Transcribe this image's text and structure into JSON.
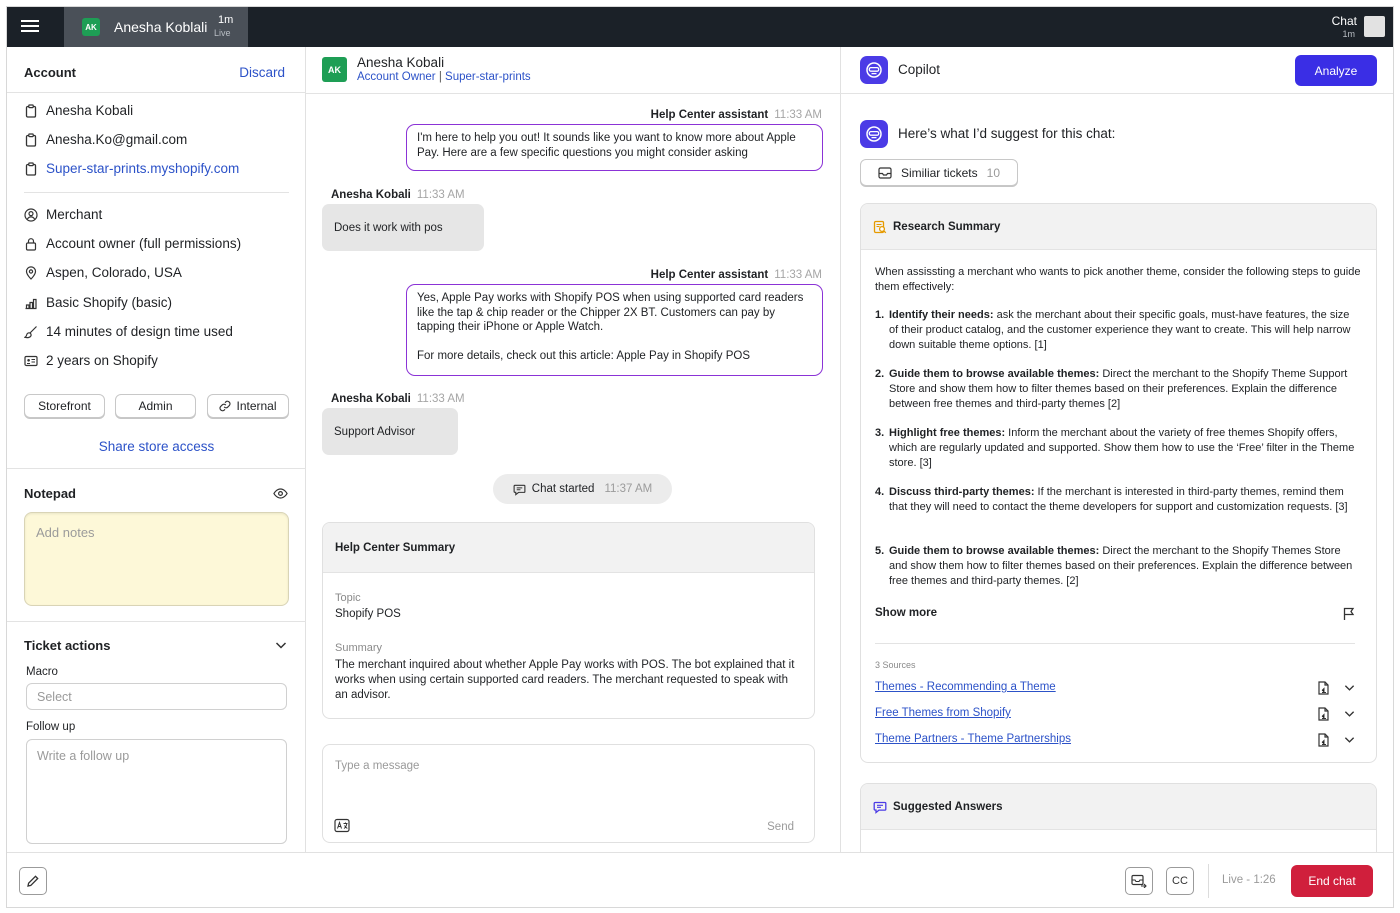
{
  "topbar": {
    "chat_tab": {
      "initials": "AK",
      "name": "Anesha Koblali",
      "time": "1m",
      "status": "Live"
    },
    "right": {
      "label": "Chat",
      "time": "1m"
    }
  },
  "account": {
    "title": "Account",
    "discard": "Discard",
    "name": "Anesha Kobali",
    "email": "Anesha.Ko@gmail.com",
    "store_url": "Super-star-prints.myshopify.com",
    "role": "Merchant",
    "permissions": "Account owner (full permissions)",
    "location": "Aspen, Colorado, USA",
    "plan": "Basic Shopify (basic)",
    "design_time": "14 minutes of design time used",
    "tenure": "2 years on Shopify",
    "buttons": {
      "storefront": "Storefront",
      "admin": "Admin",
      "internal": "Internal"
    },
    "share": "Share store access"
  },
  "notepad": {
    "title": "Notepad",
    "placeholder": "Add notes"
  },
  "ticket": {
    "title": "Ticket actions",
    "macro_label": "Macro",
    "macro_placeholder": "Select",
    "follow_label": "Follow up",
    "follow_placeholder": "Write a follow up"
  },
  "conversation": {
    "header": {
      "initials": "AK",
      "name": "Anesha Kobali",
      "role": "Account Owner",
      "store": "Super-star-prints"
    },
    "messages": [
      {
        "sender": "Help Center assistant",
        "time": "11:33 AM",
        "text": "I'm here to help you out! It sounds like you want to know more about Apple Pay. Here are a few specific questions you might consider asking"
      },
      {
        "sender": "Anesha Kobali",
        "time": "11:33 AM",
        "text": "Does it work with pos"
      },
      {
        "sender": "Help Center assistant",
        "time": "11:33 AM",
        "text": "Yes, Apple Pay works with Shopify POS when using supported card readers like the tap & chip reader or the Chipper 2X BT. Customers can pay by tapping their iPhone or Apple Watch.",
        "text2": "For more details, check out this article: Apple Pay in Shopify POS"
      },
      {
        "sender": "Anesha Kobali",
        "time": "11:33 AM",
        "text": "Support Advisor"
      }
    ],
    "chat_started": {
      "label": "Chat started",
      "time": "11:37 AM"
    },
    "summary": {
      "title": "Help Center Summary",
      "topic_label": "Topic",
      "topic": "Shopify POS",
      "summary_label": "Summary",
      "summary": "The merchant inquired about whether Apple Pay works with POS. The bot explained that it works when using certain supported card readers. The merchant requested to speak with an advisor."
    },
    "composer": {
      "placeholder": "Type a message",
      "send": "Send"
    }
  },
  "copilot": {
    "title": "Copilot",
    "analyze": "Analyze",
    "suggest": "Here’s what I’d suggest for this chat:",
    "similar": {
      "label": "Similiar tickets",
      "count": "10"
    },
    "research": {
      "title": "Research Summary",
      "intro": "When assissting a merchant who wants to pick another theme, consider the following steps to guide them effectively:",
      "steps": [
        {
          "num": "1.",
          "bold": "Identify their needs:",
          "text": " ask the merchant about their specific goals, must-have features, the size of their product catalog, and the customer experience they want to create. This will help narrow down suitable theme options. [1]"
        },
        {
          "num": "2.",
          "bold": "Guide them to browse available themes:",
          "text": " Direct the merchant to the Shopify Theme Support Store and show them how to filter themes based on their preferences. Explain the difference between free themes and third-party themes [2]"
        },
        {
          "num": "3.",
          "bold": "Highlight free themes:",
          "text": " Inform the merchant about the variety of free themes Shopify offers, which are regularly updated and supported. Show them how to use the ‘Free’ filter in the Theme store. [3]"
        },
        {
          "num": "4.",
          "bold": "Discuss third-party themes:",
          "text": " If the merchant is interested in third-party themes, remind them that they will need to contact the theme developers for support and customization requests. [3]"
        },
        {
          "num": "5.",
          "bold": "Guide them to browse available themes:",
          "text": " Direct the merchant to the Shopify Themes Store and show them how to filter themes based on their preferences. Explain the difference between free themes and third-party themes. [2]"
        }
      ],
      "show_more": "Show more",
      "sources_label": "3 Sources",
      "sources": [
        "Themes - Recommending a Theme",
        "Free Themes from Shopify",
        "Theme Partners - Theme Partnerships"
      ]
    },
    "suggested": {
      "title": "Suggested Answers"
    }
  },
  "bottom": {
    "cc": "CC",
    "live": "Live - 1:26",
    "end": "End chat"
  },
  "colors": {
    "primary": "#3a2ee5",
    "bot_border": "#8b33d6",
    "end": "#d01f3c",
    "link": "#2c52c8",
    "topbar": "#1b2128"
  }
}
